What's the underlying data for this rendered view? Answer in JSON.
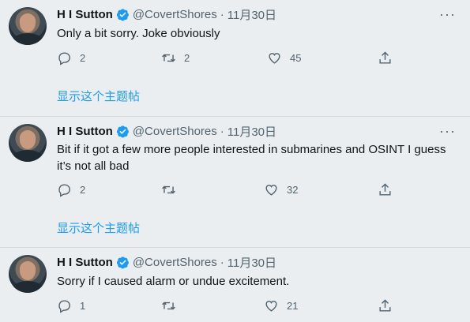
{
  "tweets": [
    {
      "author": "H I Sutton",
      "handle": "@CovertShores",
      "separator": "·",
      "date": "11月30日",
      "more": "···",
      "text": "Only a bit sorry. Joke obviously",
      "replies": "2",
      "retweets": "2",
      "likes": "45",
      "thread_link": "显示这个主题帖"
    },
    {
      "author": "H I Sutton",
      "handle": "@CovertShores",
      "separator": "·",
      "date": "11月30日",
      "more": "···",
      "text": "Bit if it got a few more people interested in submarines and OSINT I guess it’s not all bad",
      "replies": "2",
      "retweets": "",
      "likes": "32",
      "thread_link": "显示这个主题帖"
    },
    {
      "author": "H I Sutton",
      "handle": "@CovertShores",
      "separator": "·",
      "date": "11月30日",
      "more": "",
      "text": "Sorry if I caused alarm or undue excitement.",
      "replies": "1",
      "retweets": "",
      "likes": "21",
      "thread_link": ""
    }
  ],
  "icons": {
    "reply": "reply-icon",
    "retweet": "retweet-icon",
    "like": "heart-icon",
    "share": "share-icon",
    "verified": "verified-badge-icon",
    "more": "more-icon"
  },
  "colors": {
    "background": "#ebeef0",
    "accent": "#1d9bf0",
    "secondary_text": "#536471"
  }
}
